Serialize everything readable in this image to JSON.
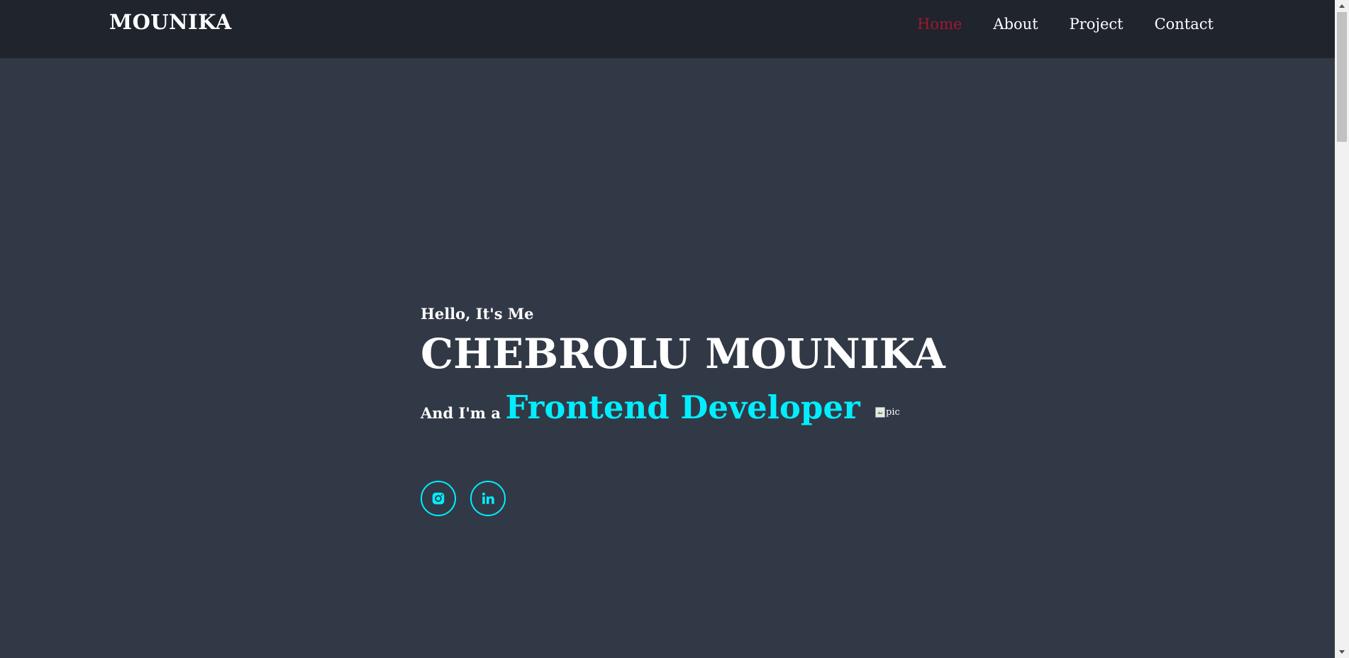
{
  "header": {
    "logo": "MOUNIKA",
    "nav": [
      {
        "label": "Home",
        "active": true
      },
      {
        "label": "About",
        "active": false
      },
      {
        "label": "Project",
        "active": false
      },
      {
        "label": "Contact",
        "active": false
      }
    ]
  },
  "hero": {
    "greeting": "Hello, It's Me",
    "name": "CHEBROLU MOUNIKA",
    "role_prefix": "And I'm a",
    "role": "Frontend Developer"
  },
  "socials": [
    {
      "icon": "instagram-icon"
    },
    {
      "icon": "linkedin-icon"
    }
  ],
  "profile_image": {
    "alt": "pic"
  },
  "colors": {
    "header_bg": "#1f242d",
    "page_bg": "#323946",
    "accent": "#00eeff",
    "nav_active": "#a3172f",
    "text": "#ffffff"
  }
}
